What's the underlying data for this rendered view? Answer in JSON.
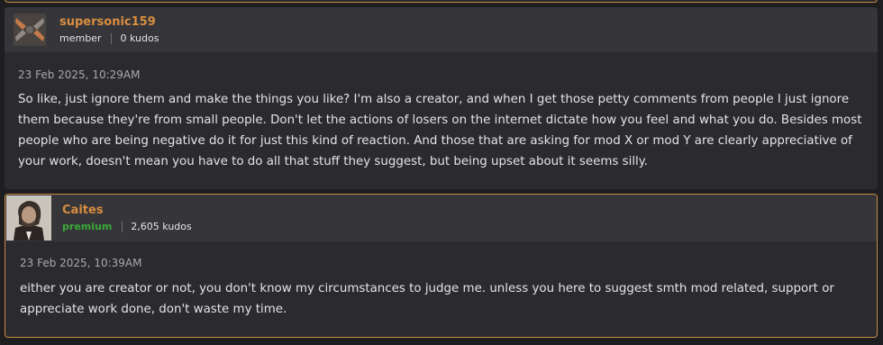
{
  "comments": [
    {
      "username": "supersonic159",
      "role": "member",
      "kudos": "0 kudos",
      "timestamp": "23 Feb 2025, 10:29AM",
      "body": "So like, just ignore them and make the things you like? I'm also a creator, and when I get those petty comments from people I just ignore them because they're from small people. Don't let the actions of losers on the internet dictate how you feel and what you do. Besides most people who are being negative do it for just this kind of reaction. And those that are asking for mod X or mod Y are clearly appreciative of your work, doesn't mean you have to do all that stuff they suggest, but being upset about it seems silly.",
      "avatar_icon": "default-avatar-icon"
    },
    {
      "username": "Caites",
      "role": "premium",
      "kudos": "2,605 kudos",
      "timestamp": "23 Feb 2025, 10:39AM",
      "body": "either you are creator or not, you don't know my circumstances to judge me. unless you here to suggest smth mod related, support or appreciate work done, don't waste my time.",
      "avatar_icon": "portrait-avatar-icon"
    }
  ],
  "colors": {
    "username": "#d98e3f",
    "premium": "#3aaa36",
    "highlight_border": "#c98a3e"
  }
}
